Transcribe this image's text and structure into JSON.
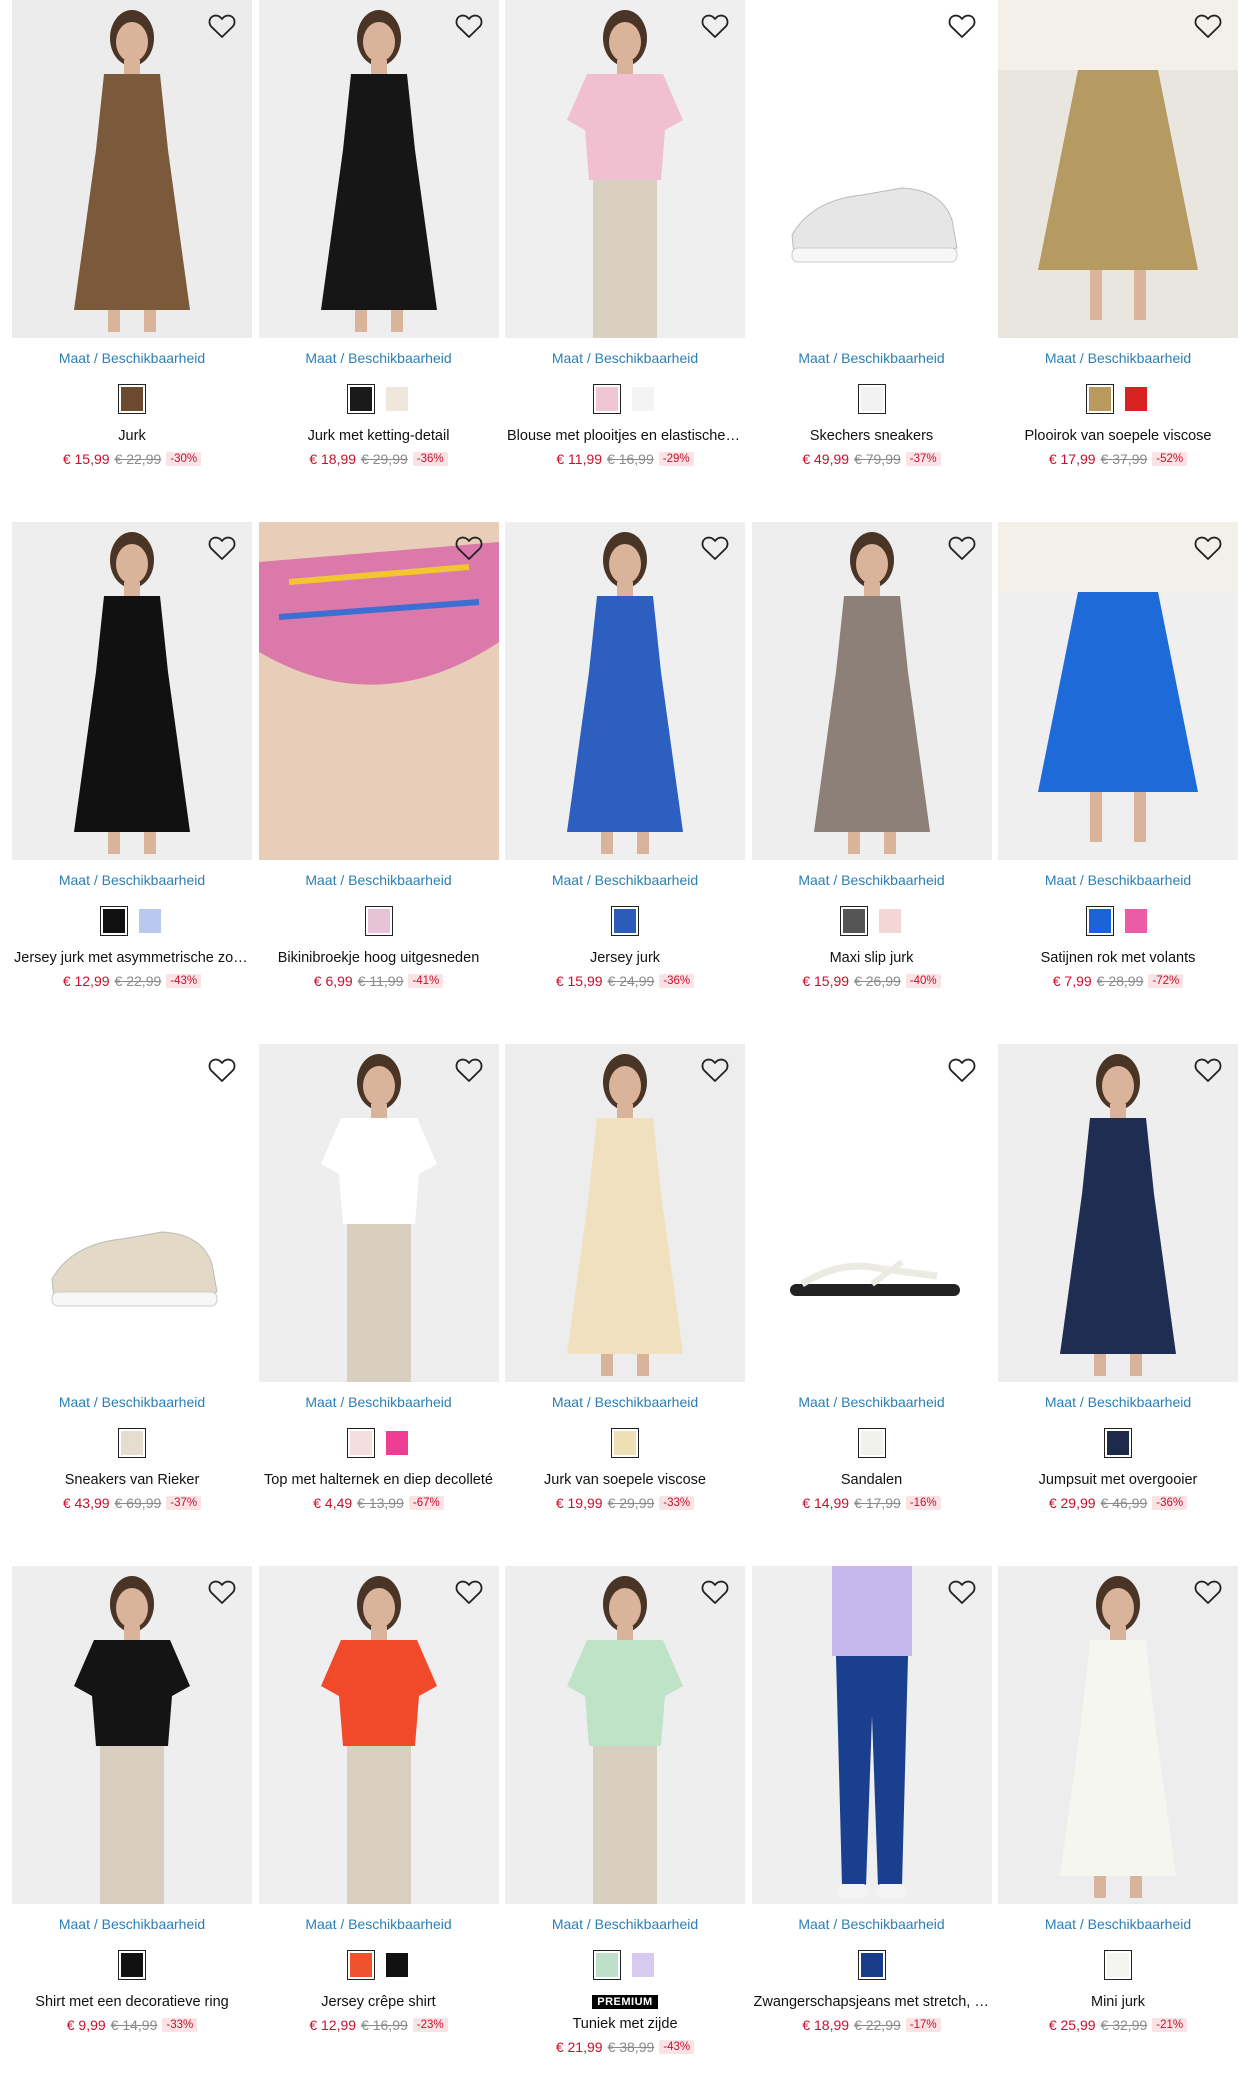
{
  "size_link_label": "Maat / Beschikbaarheid",
  "colors": {
    "price": "#c8102e",
    "link": "#2b7fb4",
    "discount_bg": "#fbe3e5"
  },
  "products": [
    {
      "title": "Jurk",
      "price": "€ 15,99",
      "old_price": "€ 22,99",
      "discount": "-30%",
      "swatches": [
        "#6b4a2e"
      ],
      "bg": "#ececec",
      "garment": "#7a5a3a",
      "kind": "dress"
    },
    {
      "title": "Jurk met ketting-detail",
      "price": "€ 18,99",
      "old_price": "€ 29,99",
      "discount": "-36%",
      "swatches": [
        "#1a1a1a",
        "#efe6dc"
      ],
      "bg": "#eeeeee",
      "garment": "#161616",
      "kind": "dress"
    },
    {
      "title": "Blouse met plooitjes en elastische …",
      "price": "€ 11,99",
      "old_price": "€ 16,99",
      "discount": "-29%",
      "swatches": [
        "#f1c6d3",
        "#f4f4f4"
      ],
      "bg": "#efefef",
      "garment": "#f0bfd0",
      "kind": "top"
    },
    {
      "title": "Skechers sneakers",
      "price": "€ 49,99",
      "old_price": "€ 79,99",
      "discount": "-37%",
      "swatches": [
        "#f2f2f2"
      ],
      "bg": "#ffffff",
      "garment": "#e6e6e6",
      "kind": "shoe"
    },
    {
      "title": "Plooirok van soepele viscose",
      "price": "€ 17,99",
      "old_price": "€ 37,99",
      "discount": "-52%",
      "swatches": [
        "#b89a5c",
        "#d92323"
      ],
      "bg": "#e9e6e0",
      "garment": "#b59a62",
      "kind": "skirt"
    },
    {
      "title": "Jersey jurk met asymmetrische zoo…",
      "price": "€ 12,99",
      "old_price": "€ 22,99",
      "discount": "-43%",
      "swatches": [
        "#111111",
        "#b9c8ee"
      ],
      "bg": "#eeeeee",
      "garment": "#111111",
      "kind": "dress"
    },
    {
      "title": "Bikinibroekje hoog uitgesneden",
      "price": "€ 6,99",
      "old_price": "€ 11,99",
      "discount": "-41%",
      "swatches": [
        "#e8c3d8"
      ],
      "bg": "#ecebea",
      "garment": "#d96aa8",
      "kind": "bikini"
    },
    {
      "title": "Jersey jurk",
      "price": "€ 15,99",
      "old_price": "€ 24,99",
      "discount": "-36%",
      "swatches": [
        "#2b5cb8"
      ],
      "bg": "#efefef",
      "garment": "#2d5fc0",
      "kind": "dress"
    },
    {
      "title": "Maxi slip jurk",
      "price": "€ 15,99",
      "old_price": "€ 26,99",
      "discount": "-40%",
      "swatches": [
        "#555555",
        "#f3d6d6"
      ],
      "bg": "#eeeeee",
      "garment": "#8c8078",
      "kind": "dress"
    },
    {
      "title": "Satijnen rok met volants",
      "price": "€ 7,99",
      "old_price": "€ 28,99",
      "discount": "-72%",
      "swatches": [
        "#1d63d8",
        "#ec5ba6"
      ],
      "bg": "#efefef",
      "garment": "#1d6ad8",
      "kind": "skirt"
    },
    {
      "title": "Sneakers van Rieker",
      "price": "€ 43,99",
      "old_price": "€ 69,99",
      "discount": "-37%",
      "swatches": [
        "#e4ddd0"
      ],
      "bg": "#ffffff",
      "garment": "#e2d9c6",
      "kind": "shoe"
    },
    {
      "title": "Top met halternek en diep decolleté",
      "price": "€ 4,49",
      "old_price": "€ 13,99",
      "discount": "-67%",
      "swatches": [
        "#f5dede",
        "#ee3d92"
      ],
      "bg": "#eeeeee",
      "garment": "#ffffff",
      "kind": "top"
    },
    {
      "title": "Jurk van soepele viscose",
      "price": "€ 19,99",
      "old_price": "€ 29,99",
      "discount": "-33%",
      "swatches": [
        "#efdfb5"
      ],
      "bg": "#ededed",
      "garment": "#f0e0bd",
      "kind": "dress"
    },
    {
      "title": "Sandalen",
      "price": "€ 14,99",
      "old_price": "€ 17,99",
      "discount": "-16%",
      "swatches": [
        "#f2f2ec"
      ],
      "bg": "#ffffff",
      "garment": "#ecebe3",
      "kind": "sandal"
    },
    {
      "title": "Jumpsuit met overgooier",
      "price": "€ 29,99",
      "old_price": "€ 46,99",
      "discount": "-36%",
      "swatches": [
        "#1d2a4a"
      ],
      "bg": "#eeeeee",
      "garment": "#1f2d52",
      "kind": "dress"
    },
    {
      "title": "Shirt met een decoratieve ring",
      "price": "€ 9,99",
      "old_price": "€ 14,99",
      "discount": "-33%",
      "swatches": [
        "#111111"
      ],
      "bg": "#eeeeee",
      "garment": "#141414",
      "kind": "top"
    },
    {
      "title": "Jersey crêpe shirt",
      "price": "€ 12,99",
      "old_price": "€ 16,99",
      "discount": "-23%",
      "swatches": [
        "#f0522f",
        "#111111"
      ],
      "bg": "#efefef",
      "garment": "#f04a2a",
      "kind": "top"
    },
    {
      "title": "Tuniek met zijde",
      "price": "€ 21,99",
      "old_price": "€ 38,99",
      "discount": "-43%",
      "swatches": [
        "#bfe0c8",
        "#d8c9ef"
      ],
      "bg": "#eeeeee",
      "garment": "#bfe3c7",
      "kind": "top",
      "premium": "PREMIUM"
    },
    {
      "title": "Zwangerschapsjeans met stretch, s…",
      "price": "€ 18,99",
      "old_price": "€ 22,99",
      "discount": "-17%",
      "swatches": [
        "#1a3d8a"
      ],
      "bg": "#efefef",
      "garment": "#1b3f8f",
      "kind": "pants"
    },
    {
      "title": "Mini jurk",
      "price": "€ 25,99",
      "old_price": "€ 32,99",
      "discount": "-21%",
      "swatches": [
        "#f4f4f0"
      ],
      "bg": "#ededed",
      "garment": "#f6f6f1",
      "kind": "dress"
    }
  ]
}
